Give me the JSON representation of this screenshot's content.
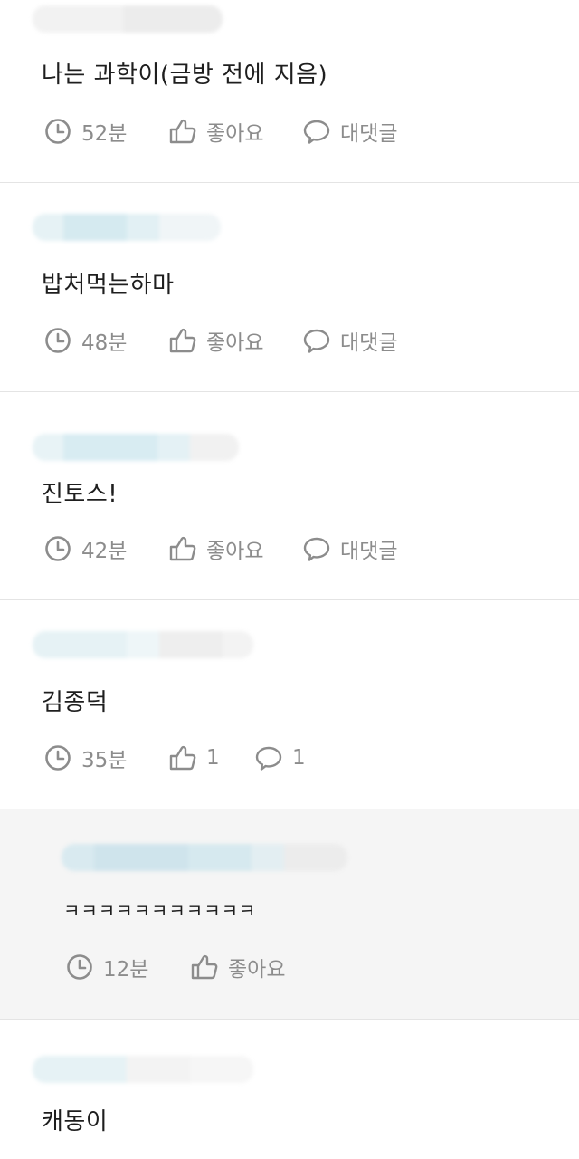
{
  "comments": [
    {
      "text": "나는 과학이(금방 전에 지음)",
      "time": "52분",
      "like": "좋아요",
      "reply": "대댓글",
      "is_reply": false
    },
    {
      "text": "밥처먹는하마",
      "time": "48분",
      "like": "좋아요",
      "reply": "대댓글",
      "is_reply": false
    },
    {
      "text": "진토스!",
      "time": "42분",
      "like": "좋아요",
      "reply": "대댓글",
      "is_reply": false
    },
    {
      "text": "김종덕",
      "time": "35분",
      "like": "1",
      "reply": "1",
      "is_reply": false
    },
    {
      "text": "ㅋㅋㅋㅋㅋㅋㅋㅋㅋㅋㅋ",
      "time": "12분",
      "like": "좋아요",
      "is_reply": true
    },
    {
      "text": "캐동이",
      "is_reply": false
    }
  ],
  "colors": {
    "background": "#ffffff",
    "reply_background": "#f5f5f5",
    "divider": "#e4e4e4",
    "meta_text": "#8c8c8c",
    "blurred_author": "#dcecf2"
  },
  "icons": [
    "clock-icon",
    "thumbs-up-icon",
    "speech-bubble-icon"
  ]
}
